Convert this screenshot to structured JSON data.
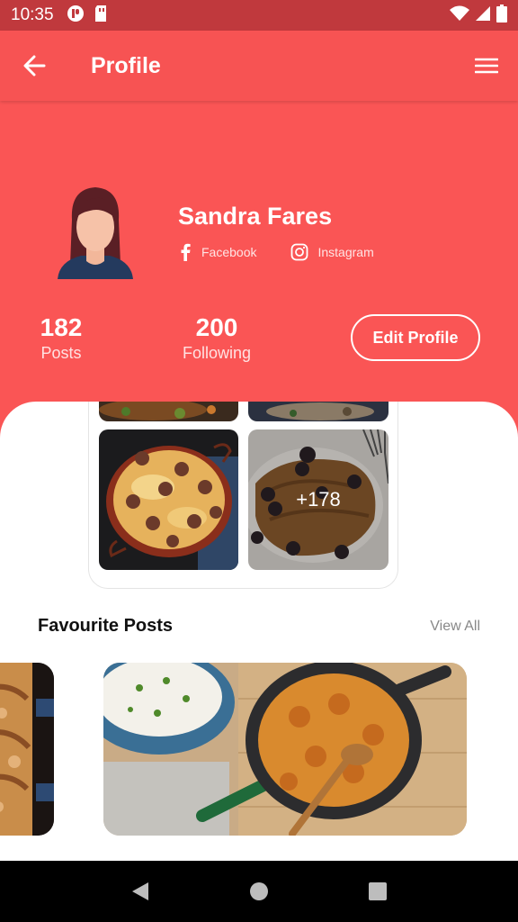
{
  "status_bar": {
    "time": "10:35"
  },
  "app_bar": {
    "title": "Profile"
  },
  "profile": {
    "name": "Sandra Fares",
    "social": [
      {
        "label": "Facebook",
        "icon": "facebook-icon"
      },
      {
        "label": "Instagram",
        "icon": "instagram-icon"
      }
    ],
    "stats": {
      "posts": {
        "value": "182",
        "label": "Posts"
      },
      "following": {
        "value": "200",
        "label": "Following"
      }
    },
    "edit_label": "Edit Profile"
  },
  "gallery": {
    "more_count": "+178"
  },
  "favourites": {
    "title": "Favourite Posts",
    "view_all": "View All"
  },
  "colors": {
    "accent": "#fa5555",
    "status_bar": "#c0393d",
    "app_bar": "#f75353"
  }
}
